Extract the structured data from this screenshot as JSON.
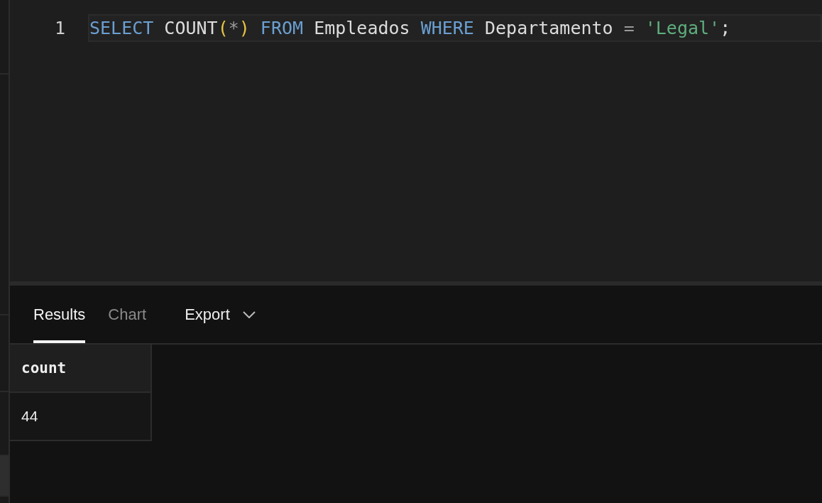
{
  "editor": {
    "lines": [
      {
        "number": "1",
        "current": true,
        "tokens": [
          {
            "kind": "keyword",
            "text": "SELECT"
          },
          {
            "kind": "plain",
            "text": " COUNT"
          },
          {
            "kind": "paren",
            "text": "("
          },
          {
            "kind": "op",
            "text": "*"
          },
          {
            "kind": "paren",
            "text": ")"
          },
          {
            "kind": "keyword",
            "text": " FROM"
          },
          {
            "kind": "plain",
            "text": " Empleados "
          },
          {
            "kind": "keyword",
            "text": "WHERE"
          },
          {
            "kind": "plain",
            "text": " Departamento "
          },
          {
            "kind": "op",
            "text": "="
          },
          {
            "kind": "string",
            "text": " 'Legal'"
          },
          {
            "kind": "plain",
            "text": ";"
          }
        ]
      }
    ]
  },
  "results": {
    "tabs": [
      {
        "label": "Results",
        "selected": true
      },
      {
        "label": "Chart",
        "selected": false
      }
    ],
    "export": {
      "label": "Export"
    },
    "table": {
      "columns": [
        "count"
      ],
      "rows": [
        [
          "44"
        ]
      ]
    }
  }
}
